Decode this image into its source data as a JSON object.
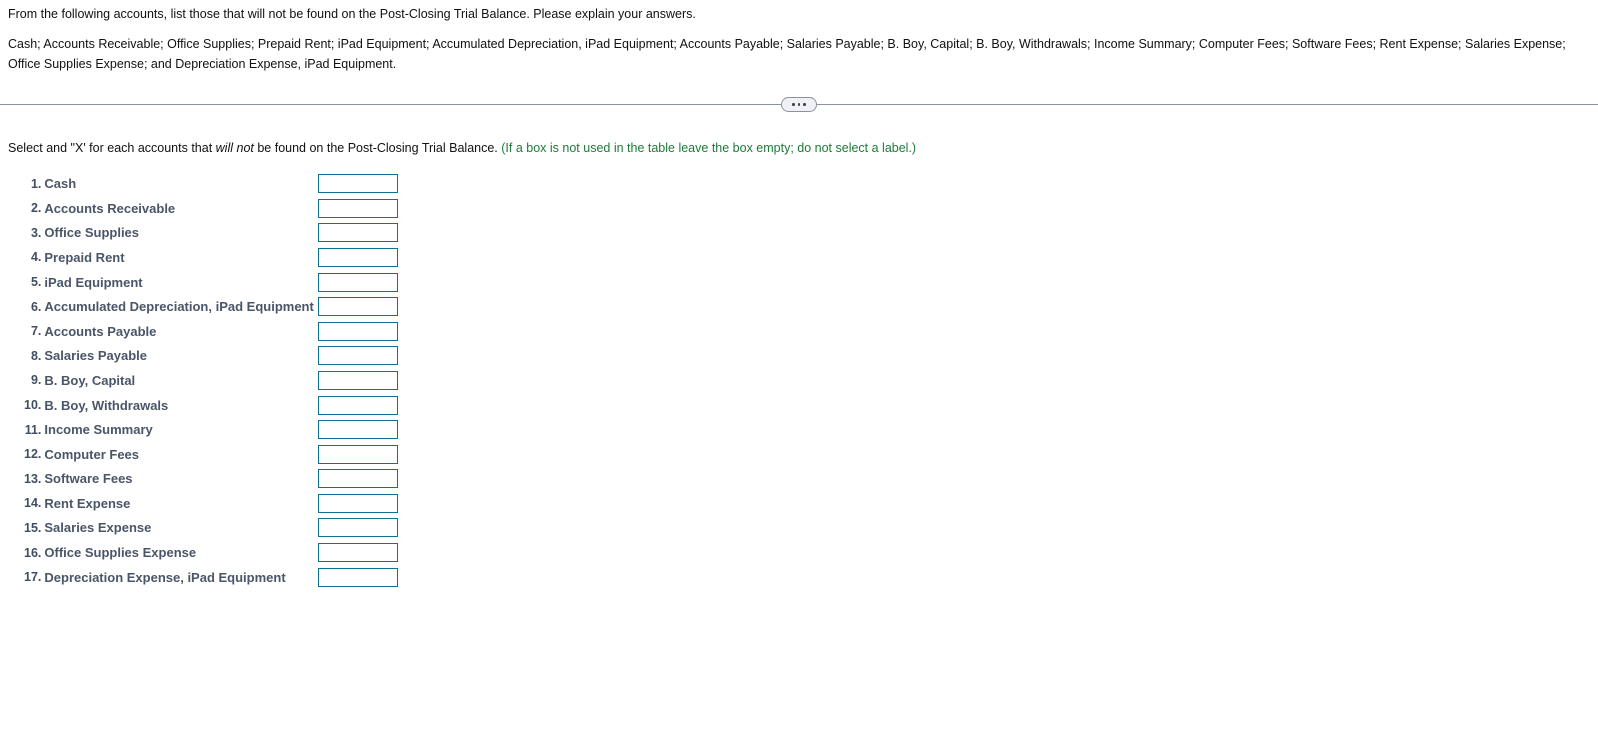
{
  "problem": {
    "question": "From the following accounts, list those that will not be found on the Post-Closing Trial Balance. Please explain your answers.",
    "accounts_list": "Cash; Accounts Receivable; Office Supplies; Prepaid Rent; iPad Equipment; Accumulated Depreciation, iPad Equipment; Accounts Payable; Salaries Payable; B. Boy, Capital; B. Boy, Withdrawals; Income Summary; Computer Fees; Software Fees; Rent Expense; Salaries Expense; Office Supplies Expense; and Depreciation Expense, iPad Equipment."
  },
  "divider": {
    "handle_icon": "ellipsis-handle-icon",
    "dots": 3
  },
  "instruction": {
    "part1": "Select and \"X' for each accounts that ",
    "emphasis": "will not",
    "part2": " be found on the Post-Closing Trial Balance.",
    "hint": "(If a box is not used in the table leave the box empty; do not select a label.)"
  },
  "colors": {
    "input_border": "#10708f",
    "hint_green": "#1d7b3a",
    "label_slate": "#4a5568",
    "divider_gray": "#8b90a3"
  },
  "accounts": [
    {
      "num": "1.",
      "label": "Cash",
      "value": ""
    },
    {
      "num": "2.",
      "label": "Accounts Receivable",
      "value": ""
    },
    {
      "num": "3.",
      "label": "Office Supplies",
      "value": ""
    },
    {
      "num": "4.",
      "label": "Prepaid Rent",
      "value": ""
    },
    {
      "num": "5.",
      "label": "iPad Equipment",
      "value": ""
    },
    {
      "num": "6.",
      "label": "Accumulated Depreciation, iPad Equipment",
      "value": ""
    },
    {
      "num": "7.",
      "label": "Accounts Payable",
      "value": ""
    },
    {
      "num": "8.",
      "label": "Salaries Payable",
      "value": ""
    },
    {
      "num": "9.",
      "label": "B. Boy, Capital",
      "value": ""
    },
    {
      "num": "10.",
      "label": "B. Boy, Withdrawals",
      "value": ""
    },
    {
      "num": "11.",
      "label": "Income Summary",
      "value": ""
    },
    {
      "num": "12.",
      "label": "Computer Fees",
      "value": ""
    },
    {
      "num": "13.",
      "label": "Software Fees",
      "value": ""
    },
    {
      "num": "14.",
      "label": "Rent Expense",
      "value": ""
    },
    {
      "num": "15.",
      "label": "Salaries Expense",
      "value": ""
    },
    {
      "num": "16.",
      "label": "Office Supplies Expense",
      "value": ""
    },
    {
      "num": "17.",
      "label": "Depreciation Expense, iPad Equipment",
      "value": ""
    }
  ]
}
